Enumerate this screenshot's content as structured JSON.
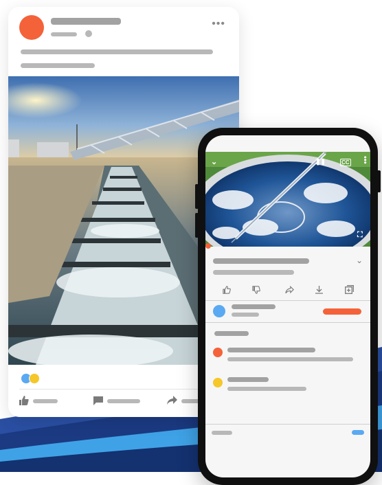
{
  "feed_post": {
    "avatar_color": "#f4623a",
    "more_icon": "more-icon",
    "reaction_colors": [
      "#5aa9f2",
      "#f5c729"
    ],
    "actions": [
      "like-icon",
      "comment-icon",
      "share-icon"
    ]
  },
  "video_app": {
    "controls": {
      "collapse_icon": "chevron-down-icon",
      "pause_icon": "pause-icon",
      "captions_label": "CC",
      "more_icon": "more-icon",
      "fullscreen_icon": "fullscreen-icon"
    },
    "progress_color": "#f4623a",
    "action_icons": [
      "thumb-up-icon",
      "thumb-down-icon",
      "share-icon",
      "download-icon",
      "add-to-playlist-icon"
    ],
    "channel_avatar_color": "#5aa9f2",
    "subscribe_color": "#f4623a",
    "comment_avatar_colors": [
      "#f4623a",
      "#f5c729"
    ],
    "toggle_color": "#5aa9f2"
  }
}
